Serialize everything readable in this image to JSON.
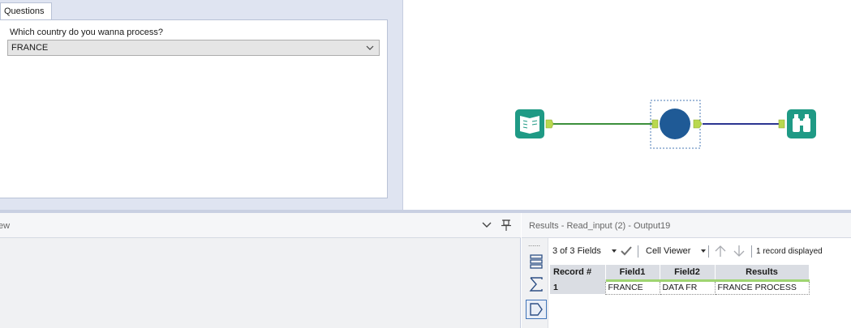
{
  "questions": {
    "tab_label": "Questions",
    "prompt": "Which country do you wanna process?",
    "selected_value": "FRANCE"
  },
  "canvas": {
    "tools": [
      {
        "name": "input-data-tool",
        "icon": "book-icon",
        "color": "#1f9a85"
      },
      {
        "name": "formula-tool",
        "icon": "circle-icon",
        "color": "#1f5a96"
      },
      {
        "name": "browse-tool",
        "icon": "binoculars-icon",
        "color": "#1f9a85"
      }
    ],
    "connection_colors": {
      "first": "#3c8f3c",
      "second": "#2b3591"
    },
    "anchor_color": "#b9d84f"
  },
  "view_panel": {
    "title": "ew"
  },
  "results": {
    "title": "Results - Read_input (2) - Output19",
    "toolbar": {
      "fields_label": "3 of 3 Fields",
      "viewer_label": "Cell Viewer",
      "status": "1 record displayed"
    },
    "side_dots": "......",
    "columns": [
      "Record #",
      "Field1",
      "Field2",
      "Results"
    ],
    "rows": [
      {
        "record": "1",
        "field1": "FRANCE",
        "field2": "DATA FR",
        "results": "FRANCE PROCESS"
      }
    ]
  }
}
